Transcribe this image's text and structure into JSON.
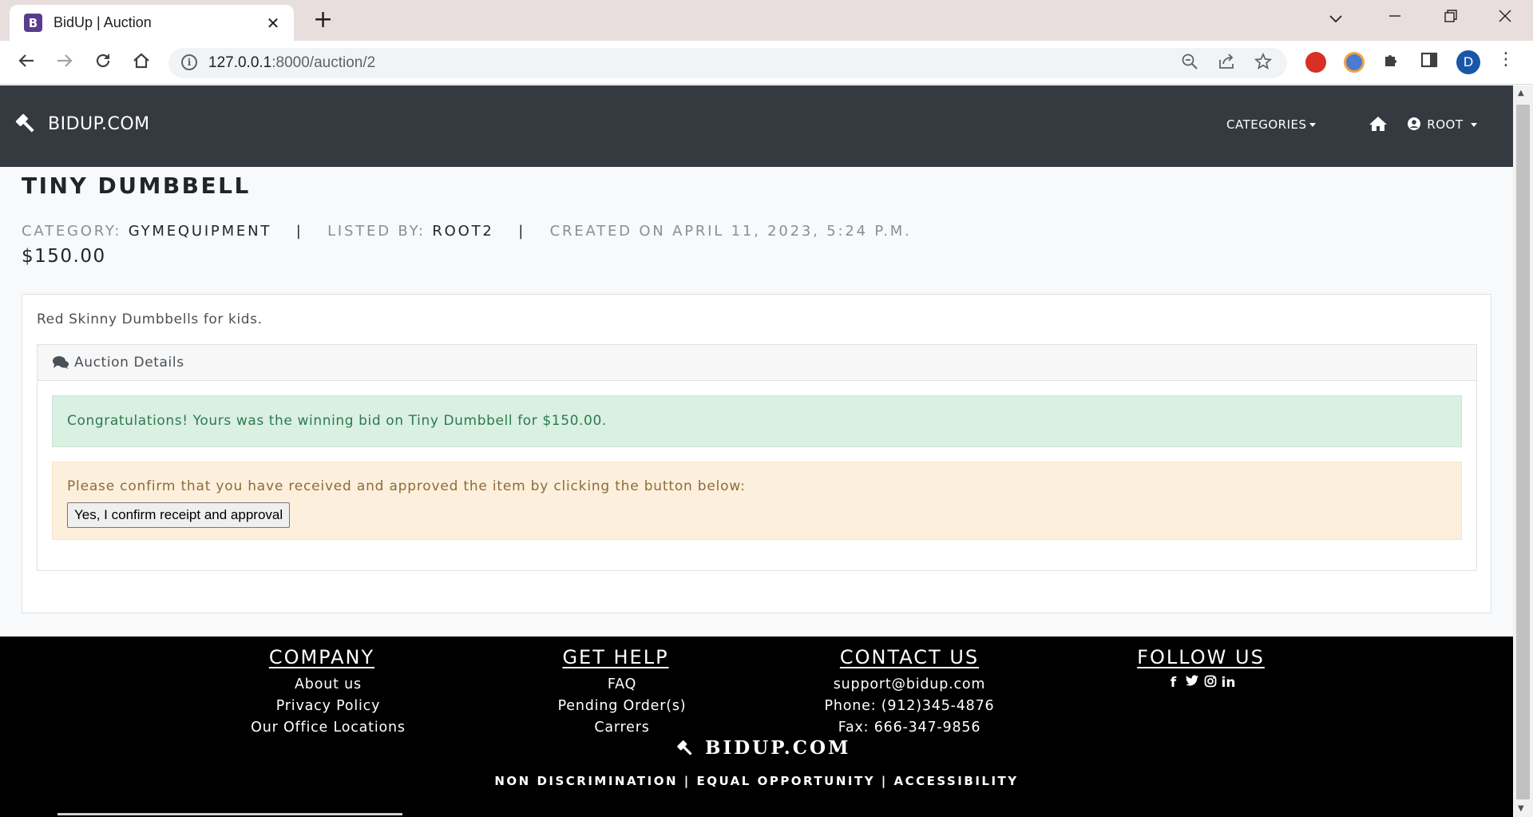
{
  "browser": {
    "tab_title": "BidUp | Auction",
    "tab_favicon_letter": "B",
    "url_host": "127.0.0.1",
    "url_path": ":8000/auction/2",
    "profile_initial": "D"
  },
  "navbar": {
    "brand": "BIDUP.COM",
    "categories": "CATEGORIES",
    "user": "ROOT"
  },
  "listing": {
    "title": "TINY DUMBBELL",
    "category_label": "CATEGORY:",
    "category_value": "GYMEQUIPMENT",
    "separator": "|",
    "listed_by_label": "LISTED BY:",
    "listed_by_value": "ROOT2",
    "created_on": "CREATED ON APRIL 11, 2023, 5:24 P.M.",
    "price": "$150.00",
    "description": "Red Skinny Dumbbells for kids."
  },
  "details": {
    "header": "Auction Details",
    "success_message": "Congratulations! Yours was the winning bid on Tiny Dumbbell for $150.00.",
    "confirm_prompt": "Please confirm that you have received and approved the item by clicking the button below:",
    "confirm_button": "Yes, I confirm receipt and approval"
  },
  "footer": {
    "company": {
      "heading": "COMPANY",
      "links": [
        "About us",
        "Privacy Policy",
        "Our Office Locations"
      ]
    },
    "help": {
      "heading": "GET HELP",
      "links": [
        "FAQ",
        "Pending Order(s)",
        "Carrers"
      ]
    },
    "contact": {
      "heading": "CONTACT US",
      "links": [
        "support@bidup.com",
        "Phone: (912)345-4876",
        "Fax: 666-347-9856"
      ]
    },
    "follow": {
      "heading": "FOLLOW US",
      "icons": [
        "facebook-icon",
        "twitter-icon",
        "instagram-icon",
        "linkedin-icon"
      ]
    },
    "brand": "BIDUP.COM",
    "legal": "NON DISCRIMINATION | EQUAL OPPORTUNITY | ACCESSIBILITY"
  },
  "colors": {
    "navbar_bg": "#343a40",
    "footer_bg": "#000000",
    "success_bg": "#d9f0e3",
    "warning_bg": "#fcefdc"
  }
}
